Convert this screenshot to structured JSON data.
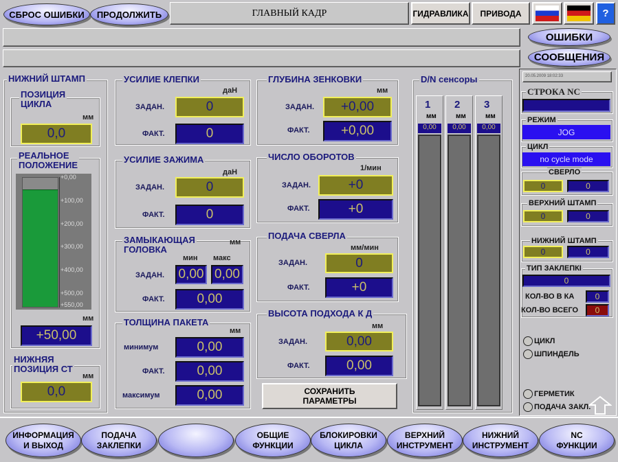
{
  "top": {
    "reset_errors": "СБРОС ОШИБКИ",
    "continue": "ПРОДОЛЖИТЬ",
    "title": "ГЛАВНЫЙ КАДР",
    "hydraulics": "ГИДРАВЛИКА",
    "drives": "ПРИВОДА",
    "help": "?",
    "errors": "ОШИБКИ",
    "messages": "СООБЩЕНИЯ",
    "message_line_1": "",
    "message_line_2": ""
  },
  "lower_die": {
    "title": "НИЖНИЙ ШТАМП",
    "cycle_pos_title1": "ПОЗИЦИЯ",
    "cycle_pos_title2": "ЦИКЛА",
    "unit": "мм",
    "cycle_pos": "0,0",
    "real_title1": "РЕАЛЬНОЕ",
    "real_title2": "ПОЛОЖЕНИЕ",
    "gauge_ticks": [
      "+0,00",
      "+100,00",
      "+200,00",
      "+300,00",
      "+400,00",
      "+500,00",
      "+550,00"
    ],
    "gauge_fill_fraction": 0.91,
    "real_pos": "+50,00",
    "low_title1": "НИЖНЯЯ",
    "low_title2": "ПОЗИЦИЯ СТ",
    "low_pos": "0,0"
  },
  "labels": {
    "set": "ЗАДАН.",
    "act": "ФАКТ.",
    "min": "мин",
    "max": "макс",
    "minimum": "минимум",
    "maximum": "максимум"
  },
  "rivet_force": {
    "title": "УСИЛИЕ КЛЕПКИ",
    "unit": "даН",
    "set": "0",
    "act": "0"
  },
  "clamp_force": {
    "title": "УСИЛИЕ ЗАЖИМА",
    "unit": "даН",
    "set": "0",
    "act": "0"
  },
  "closing_head": {
    "title1": "ЗАМЫКАЮЩАЯ",
    "title2": "ГОЛОВКА",
    "unit": "мм",
    "set_min": "0,00",
    "set_max": "0,00",
    "act": "0,00"
  },
  "stack": {
    "title": "ТОЛЩИНА ПАКЕТА",
    "unit": "мм",
    "min": "0,00",
    "act": "0,00",
    "max": "0,00"
  },
  "countersink": {
    "title": "ГЛУБИНА ЗЕНКОВКИ",
    "unit": "мм",
    "set": "+0,00",
    "act": "+0,00"
  },
  "rpm": {
    "title": "ЧИСЛО ОБОРОТОВ",
    "unit": "1/мин",
    "set": "+0",
    "act": "+0"
  },
  "feed": {
    "title": "ПОДАЧА СВЕРЛА",
    "unit": "мм/мин",
    "set": "0",
    "act": "+0"
  },
  "approach": {
    "title": "ВЫСОТА ПОДХОДА К Д",
    "unit": "мм",
    "set": "0,00",
    "act": "0,00"
  },
  "save": {
    "line1": "СОХРАНИТЬ",
    "line2": "ПАРАМЕТРЫ"
  },
  "dn": {
    "title": "D/N сенсоры",
    "sensors": [
      {
        "n": "1",
        "unit": "мм",
        "val": "0,00"
      },
      {
        "n": "2",
        "unit": "мм",
        "val": "0,00"
      },
      {
        "n": "3",
        "unit": "мм",
        "val": "0,00"
      }
    ]
  },
  "right": {
    "timestamp": "20.05.2009 18:02:33",
    "nc_title": "СТРОКА NC",
    "nc": "",
    "mode_title": "РЕЖИМ",
    "mode": "JOG",
    "cycle_title": "ЦИКЛ",
    "cycle": "no cycle mode",
    "drill_title": "СВЕРЛО",
    "drill": [
      "0",
      "0"
    ],
    "upper_title": "ВЕРХНИЙ ШТАМП",
    "upper": [
      "0",
      "0"
    ],
    "lower_title": "НИЖНИЙ ШТАМП",
    "lower": [
      "0",
      "0"
    ],
    "rivet_type_title": "ТИП ЗАКЛЕПКІ",
    "rivet_type": "0",
    "count_ka_label": "КОЛ-ВО В КА",
    "count_ka": "0",
    "count_total_label": "КОЛ-ВО ВСЕГО",
    "count_total": "0",
    "radios": [
      "ЦИКЛ",
      "ШПИНДЕЛЬ",
      "ГЕРМЕТИК",
      "ПОДАЧА ЗАКЛ."
    ]
  },
  "bottom": [
    {
      "l1": "ИНФОРМАЦИЯ",
      "l2": "И ВЫХОД"
    },
    {
      "l1": "ПОДАЧА",
      "l2": "ЗАКЛЕПКИ"
    },
    {
      "l1": "",
      "l2": ""
    },
    {
      "l1": "ОБЩИЕ",
      "l2": "ФУНКЦИИ"
    },
    {
      "l1": "БЛОКИРОВКИ",
      "l2": "ЦИКЛА"
    },
    {
      "l1": "ВЕРХНИЙ",
      "l2": "ИНСТРУМЕНТ"
    },
    {
      "l1": "НИЖНИЙ",
      "l2": "ИНСТРУМЕНТ"
    },
    {
      "l1": "NC",
      "l2": "ФУНКЦИИ"
    }
  ],
  "colors": {
    "olive": "#807e22",
    "blue": "#1c0e8c",
    "bright_blue": "#2a10f0",
    "red": "#8a0c0c",
    "green": "#1a9a3a"
  }
}
